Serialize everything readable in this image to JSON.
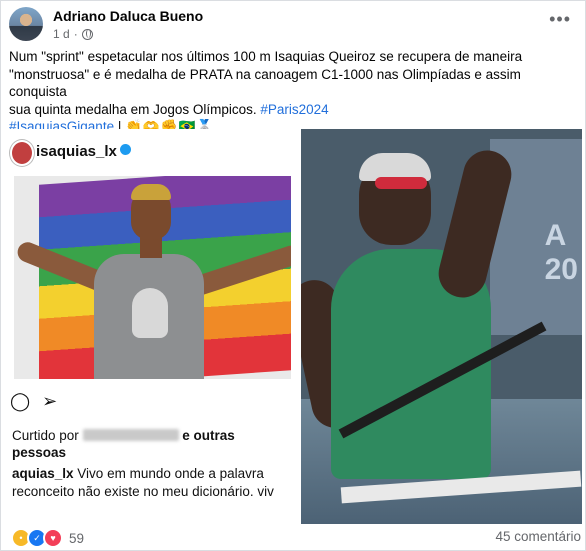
{
  "post": {
    "author": "Adriano Daluca Bueno",
    "time": "1 d",
    "separator": "·",
    "more_icon": "more-horizontal-icon",
    "text_line1": "Num \"sprint\" espetacular nos últimos 100 m Isaquias Queiroz se recupera de maneira",
    "text_line2": "\"monstruosa\" e é medalha de PRATA na canoagem  C1-1000 nas Olimpíadas e assim conquista",
    "text_line3": "sua quinta medalha em Jogos Olímpicos. ",
    "hashtag_paris": "#Paris2024",
    "hashtag_isaquias": "#IsaquiasGigante",
    "after_hashtag": " | ",
    "emojis": "👏🫶✊🇧🇷🥈"
  },
  "instagram_card": {
    "username": "isaquias_lx",
    "liked_prefix": "Curtido por ",
    "liked_suffix": " e outras",
    "liked_line2": "pessoas",
    "caption_user": "aquias_lx",
    "caption_line1": " Vivo em mundo onde a palavra",
    "caption_line2": "reconceito não existe no meu dicionário. viv"
  },
  "right_photo": {
    "scoreboard_text": "A\n20"
  },
  "footer": {
    "reaction_count": "59",
    "comments": "45 comentário"
  },
  "colors": {
    "link": "#216fdb",
    "meta": "#65676b",
    "like": "#1877f2",
    "love": "#f33e58",
    "sad": "#f7b928"
  }
}
